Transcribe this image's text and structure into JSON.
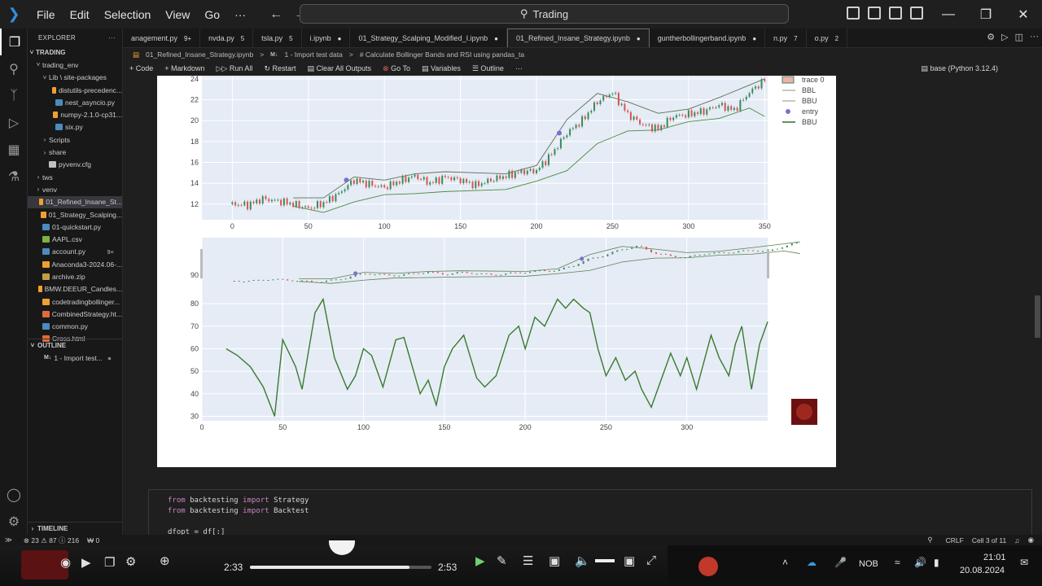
{
  "titlebar": {
    "menu": [
      "File",
      "Edit",
      "Selection",
      "View",
      "Go",
      "···"
    ],
    "search": "Trading"
  },
  "explorer": {
    "header": "EXPLORER",
    "root": "TRADING",
    "items": [
      {
        "label": "trading_env",
        "indent": 1,
        "chev": "v"
      },
      {
        "label": "Lib \\ site-packages",
        "indent": 2,
        "chev": "v"
      },
      {
        "label": "distutils-precedenc...",
        "indent": 3,
        "chev": ""
      },
      {
        "label": "nest_asyncio.py",
        "indent": 3,
        "chev": ""
      },
      {
        "label": "numpy-2.1.0-cp31...",
        "indent": 3,
        "chev": ""
      },
      {
        "label": "six.py",
        "indent": 3,
        "chev": ""
      },
      {
        "label": "Scripts",
        "indent": 2,
        "chev": ">"
      },
      {
        "label": "share",
        "indent": 2,
        "chev": ">"
      },
      {
        "label": "pyvenv.cfg",
        "indent": 2,
        "chev": ""
      },
      {
        "label": "tws",
        "indent": 1,
        "chev": ">"
      },
      {
        "label": "venv",
        "indent": 1,
        "chev": ">"
      },
      {
        "label": "01_Refined_Insane_St...",
        "indent": 1,
        "chev": "",
        "selected": true
      },
      {
        "label": "01_Strategy_Scalping...",
        "indent": 1,
        "chev": ""
      },
      {
        "label": "01-quickstart.py",
        "indent": 1,
        "chev": ""
      },
      {
        "label": "AAPL.csv",
        "indent": 1,
        "chev": ""
      },
      {
        "label": "account.py",
        "indent": 1,
        "chev": "",
        "badge": "9+"
      },
      {
        "label": "Anaconda3-2024.06-...",
        "indent": 1,
        "chev": ""
      },
      {
        "label": "archive.zip",
        "indent": 1,
        "chev": ""
      },
      {
        "label": "BMW.DEEUR_Candles...",
        "indent": 1,
        "chev": ""
      },
      {
        "label": "codetradingbollinger...",
        "indent": 1,
        "chev": ""
      },
      {
        "label": "CombinedStrategy.ht...",
        "indent": 1,
        "chev": ""
      },
      {
        "label": "common.py",
        "indent": 1,
        "chev": ""
      },
      {
        "label": "Cross.html",
        "indent": 1,
        "chev": ""
      }
    ],
    "outline_header": "OUTLINE",
    "outline_item": "1 - Import test...",
    "timeline_header": "TIMELINE"
  },
  "tabs": [
    {
      "label": "anagement.py",
      "badge": "9+"
    },
    {
      "label": "nvda.py",
      "badge": "5"
    },
    {
      "label": "tsla.py",
      "badge": "5"
    },
    {
      "label": "i.ipynb",
      "badge": "●"
    },
    {
      "label": "01_Strategy_Scalping_Modified_I.ipynb",
      "badge": "●"
    },
    {
      "label": "01_Refined_Insane_Strategy.ipynb",
      "badge": "●",
      "active": true
    },
    {
      "label": "guntherbollingerband.ipynb",
      "badge": "●"
    },
    {
      "label": "n.py",
      "badge": "7"
    },
    {
      "label": "o.py",
      "badge": "2"
    }
  ],
  "breadcrumb": [
    "01_Refined_Insane_Strategy.ipynb",
    "1 - Import test data",
    "# Calculate Bollinger Bands and RSI using pandas_ta"
  ],
  "nbtoolbar": {
    "items": [
      "+ Code",
      "+ Markdown",
      "Run All",
      "Restart",
      "Clear All Outputs",
      "Go To",
      "Variables",
      "Outline",
      "···"
    ],
    "kernel": "base (Python 3.12.4)"
  },
  "chart_data": [
    {
      "type": "line",
      "title": "",
      "ylim": [
        10.5,
        24.3
      ],
      "xlim": [
        -20,
        352
      ],
      "xticks": [
        0,
        50,
        100,
        150,
        200,
        250,
        300,
        350
      ],
      "yticks": [
        12,
        14,
        16,
        18,
        20,
        22,
        24
      ],
      "legend": [
        "trace 0",
        "BBL",
        "BBU",
        "entry",
        "BBU"
      ],
      "legend_position": "top-right",
      "series": [
        {
          "name": "trace 0",
          "x": [
            0,
            10,
            20,
            30,
            40,
            50,
            60,
            70,
            80,
            90,
            100,
            110,
            120,
            130,
            140,
            150,
            160,
            170,
            180,
            190,
            200,
            210,
            220,
            230,
            240,
            250,
            260,
            270,
            280,
            290,
            300,
            310,
            320,
            330,
            340,
            350
          ],
          "y": [
            12.0,
            11.9,
            12.5,
            12.3,
            12.0,
            11.6,
            12.1,
            13.0,
            14.3,
            13.9,
            13.6,
            14.2,
            14.7,
            14.0,
            14.6,
            14.3,
            13.8,
            14.3,
            14.7,
            15.1,
            15.2,
            16.8,
            18.8,
            20.0,
            21.8,
            22.7,
            20.6,
            19.6,
            19.2,
            20.4,
            20.6,
            20.9,
            21.5,
            21.0,
            22.7,
            23.9
          ]
        },
        {
          "name": "BBL",
          "x": [
            40,
            60,
            80,
            100,
            120,
            140,
            160,
            180,
            200,
            220,
            240,
            260,
            280,
            300,
            320,
            340,
            350
          ],
          "y": [
            11.8,
            11.2,
            12.2,
            12.9,
            13.0,
            13.2,
            13.3,
            13.4,
            14.2,
            15.2,
            17.8,
            19.0,
            19.1,
            19.9,
            20.2,
            21.2,
            20.4
          ]
        },
        {
          "name": "BBU",
          "x": [
            40,
            60,
            80,
            100,
            120,
            140,
            160,
            180,
            200,
            220,
            240,
            260,
            280,
            300,
            320,
            340,
            350
          ],
          "y": [
            12.6,
            12.6,
            14.6,
            14.3,
            14.9,
            15.1,
            15.0,
            14.9,
            15.7,
            20.1,
            22.6,
            21.8,
            20.7,
            21.1,
            22.2,
            23.4,
            24.0
          ]
        },
        {
          "name": "entry",
          "x": [
            75,
            215
          ],
          "y": [
            14.3,
            18.8
          ]
        }
      ]
    },
    {
      "type": "line",
      "title": "",
      "ylim": [
        28,
        88
      ],
      "xlim": [
        0,
        350
      ],
      "xticks": [
        0,
        50,
        100,
        150,
        200,
        250,
        300
      ],
      "yticks": [
        30,
        40,
        50,
        60,
        70,
        80,
        90
      ],
      "series": [
        {
          "name": "",
          "x": [
            15,
            22,
            30,
            38,
            45,
            50,
            58,
            62,
            70,
            75,
            82,
            90,
            95,
            100,
            105,
            112,
            120,
            125,
            135,
            140,
            145,
            150,
            155,
            162,
            170,
            175,
            182,
            190,
            196,
            200,
            206,
            212,
            220,
            225,
            230,
            236,
            240,
            245,
            250,
            256,
            262,
            268,
            272,
            278,
            286,
            290,
            296,
            300,
            306,
            315,
            320,
            326,
            330,
            334,
            340,
            345,
            350
          ],
          "y": [
            60,
            57,
            52,
            43,
            30,
            64,
            52,
            42,
            76,
            82,
            56,
            42,
            48,
            60,
            57,
            43,
            64,
            65,
            40,
            46,
            35,
            52,
            60,
            66,
            47,
            43,
            48,
            66,
            70,
            60,
            74,
            70,
            82,
            78,
            82,
            78,
            76,
            60,
            48,
            56,
            46,
            50,
            42,
            34,
            50,
            58,
            48,
            56,
            42,
            66,
            56,
            48,
            62,
            70,
            42,
            62,
            72
          ]
        }
      ]
    }
  ],
  "code": [
    {
      "kw": "from",
      "mod": "backtesting",
      "kw2": "import",
      "name": "Strategy"
    },
    {
      "kw": "from",
      "mod": "backtesting",
      "kw2": "import",
      "name": "Backtest"
    }
  ],
  "code_line3": "dfopt = df[:]",
  "statusbar": {
    "errors": "⊗ 23 ⚠ 87 ⓘ 216",
    "ports": "₩ 0",
    "eol": "CRLF",
    "cell": "Cell 3 of 11"
  },
  "player": {
    "current_time": "2:33",
    "duration": "2:53",
    "progress": 0.88
  },
  "tray": {
    "lang": "NOB",
    "time": "21:01",
    "date": "20.08.2024"
  },
  "colors": {
    "accent": "#2f8fe0",
    "bb_line": "#3a7a2e",
    "candle_up": "#3a8a5a",
    "candle_down": "#d9534f",
    "entry": "#7b6fd0",
    "plot_bg": "#e5ecf6"
  }
}
